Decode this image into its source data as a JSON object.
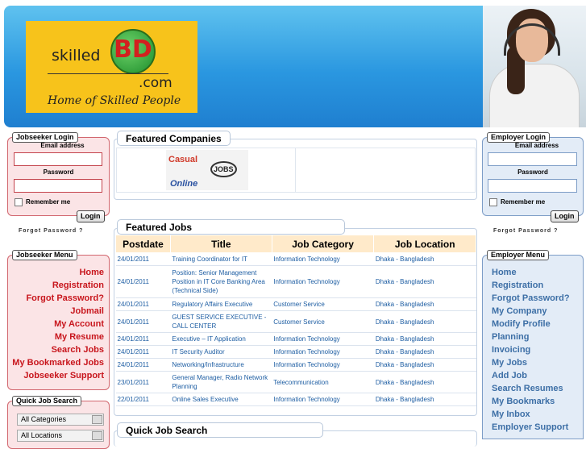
{
  "header": {
    "brand_text": "skilled",
    "brand_bd": "BD",
    "brand_com": ".com",
    "tagline": "Home of Skilled People"
  },
  "jobseeker_login": {
    "title": "Jobseeker Login",
    "email_label": "Email address",
    "password_label": "Password",
    "remember_label": "Remember me",
    "login_button": "Login",
    "forgot_label": "Forgot Password ?"
  },
  "employer_login": {
    "title": "Employer Login",
    "email_label": "Email address",
    "password_label": "Password",
    "remember_label": "Remember me",
    "login_button": "Login",
    "forgot_label": "Forgot Password ?"
  },
  "jobseeker_menu": {
    "title": "Jobseeker Menu",
    "items": [
      "Home",
      "Registration",
      "Forgot Password?",
      "Jobmail",
      "My Account",
      "My Resume",
      "Search Jobs",
      "My Bookmarked Jobs",
      "Jobseeker Support"
    ]
  },
  "employer_menu": {
    "title": "Employer Menu",
    "items": [
      "Home",
      "Registration",
      "Forgot Password?",
      "My Company",
      "Modify Profile",
      "Planning",
      "Invoicing",
      "My Jobs",
      "Add Job",
      "Search Resumes",
      "My Bookmarks",
      "My Inbox",
      "Employer Support"
    ]
  },
  "quick_search_side": {
    "title": "Quick Job Search",
    "category": "All Categories",
    "location": "All Locations"
  },
  "featured_companies": {
    "title": "Featured Companies",
    "logo_line1": "Casual",
    "logo_line2": "JOBS",
    "logo_line3": "Online"
  },
  "featured_jobs": {
    "title": "Featured Jobs",
    "columns": [
      "Postdate",
      "Title",
      "Job Category",
      "Job Location"
    ],
    "rows": [
      [
        "24/01/2011",
        "Training Coordinator for IT",
        "Information Technology",
        "Dhaka - Bangladesh"
      ],
      [
        "24/01/2011",
        "Position: Senior Management Position in IT Core Banking Area (Technical Side)",
        "Information Technology",
        "Dhaka - Bangladesh"
      ],
      [
        "24/01/2011",
        "Regulatory Affairs Executive",
        "Customer Service",
        "Dhaka - Bangladesh"
      ],
      [
        "24/01/2011",
        "GUEST SERVICE EXECUTIVE - CALL CENTER",
        "Customer Service",
        "Dhaka - Bangladesh"
      ],
      [
        "24/01/2011",
        "Executive – IT Application",
        "Information Technology",
        "Dhaka - Bangladesh"
      ],
      [
        "24/01/2011",
        "IT Security Auditor",
        "Information Technology",
        "Dhaka - Bangladesh"
      ],
      [
        "24/01/2011",
        "Networking/Infrastructure",
        "Information Technology",
        "Dhaka - Bangladesh"
      ],
      [
        "23/01/2011",
        "General Manager, Radio Network Planning",
        "Telecommunication",
        "Dhaka - Bangladesh"
      ],
      [
        "22/01/2011",
        "Online Sales Executive",
        "Information Technology",
        "Dhaka - Bangladesh"
      ]
    ]
  },
  "quick_job_search": {
    "title": "Quick Job Search"
  }
}
